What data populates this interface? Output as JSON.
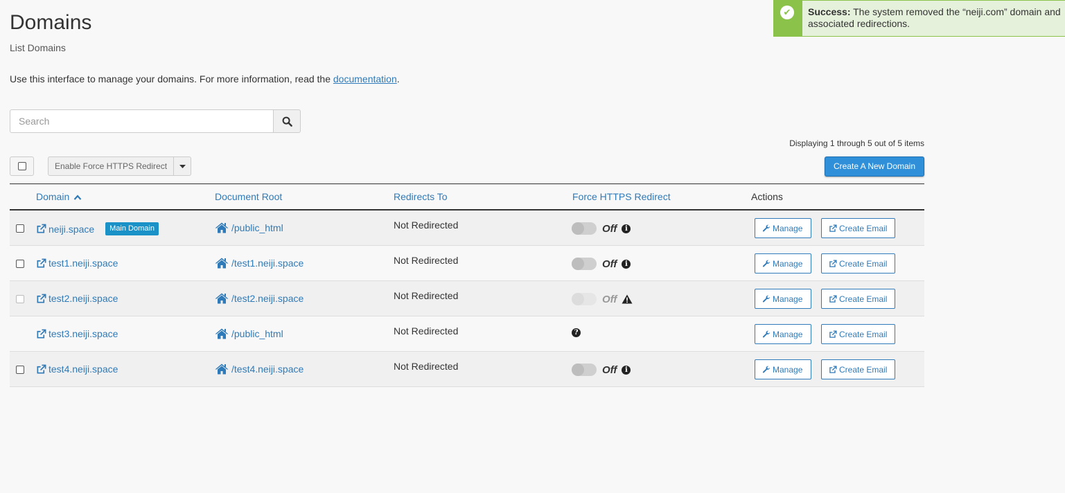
{
  "page": {
    "title": "Domains",
    "subtitle": "List Domains",
    "intro_text": "Use this interface to manage your domains. For more information, read the ",
    "intro_link": "documentation",
    "intro_end": "."
  },
  "alert": {
    "label": "Success:",
    "message": "The system removed the “neiji.com” domain and associated redirections.",
    "color": "#8bc34a"
  },
  "search": {
    "placeholder": "Search",
    "value": ""
  },
  "toolbar": {
    "bulk_action_label": "Enable Force HTTPS Redirect",
    "create_label": "Create A New Domain",
    "display_count": "Displaying 1 through 5 out of 5 items"
  },
  "table": {
    "headers": {
      "domain": "Domain",
      "document_root": "Document Root",
      "redirects_to": "Redirects To",
      "force_https": "Force HTTPS Redirect",
      "actions": "Actions"
    },
    "rows": [
      {
        "domain": "neiji.space",
        "badge": "Main Domain",
        "root": "/public_html",
        "redirect": "Not Redirected",
        "https": "Off",
        "status_icon": "info-icon",
        "checkbox": true,
        "manage": "Manage",
        "email": "Create Email"
      },
      {
        "domain": "test1.neiji.space",
        "badge": "",
        "root": "/test1.neiji.space",
        "redirect": "Not Redirected",
        "https": "Off",
        "status_icon": "info-icon",
        "checkbox": true,
        "manage": "Manage",
        "email": "Create Email"
      },
      {
        "domain": "test2.neiji.space",
        "badge": "",
        "root": "/test2.neiji.space",
        "redirect": "Not Redirected",
        "https": "Off",
        "status_icon": "warning-icon",
        "checkbox": true,
        "manage": "Manage",
        "email": "Create Email"
      },
      {
        "domain": "test3.neiji.space",
        "badge": "",
        "root": "/public_html",
        "redirect": "Not Redirected",
        "https": "",
        "status_icon": "question-icon",
        "checkbox": false,
        "manage": "Manage",
        "email": "Create Email"
      },
      {
        "domain": "test4.neiji.space",
        "badge": "",
        "root": "/test4.neiji.space",
        "redirect": "Not Redirected",
        "https": "Off",
        "status_icon": "info-icon",
        "checkbox": true,
        "manage": "Manage",
        "email": "Create Email"
      }
    ]
  }
}
